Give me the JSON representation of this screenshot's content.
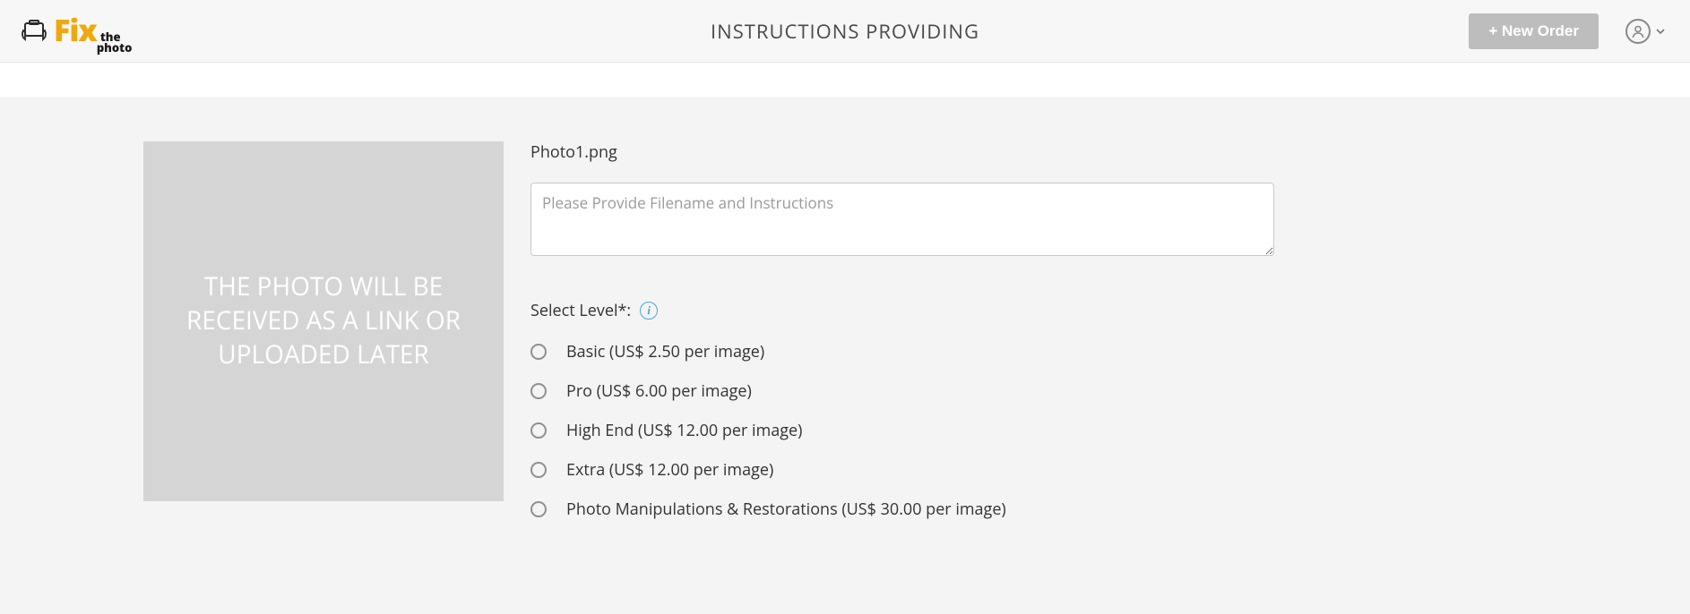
{
  "header": {
    "page_title": "INSTRUCTIONS PROVIDING",
    "new_order_label": "+ New Order",
    "logo": {
      "fix": "Fix",
      "the": "the",
      "photo": "photo"
    }
  },
  "photo": {
    "placeholder_text": "THE PHOTO WILL BE RECEIVED AS A LINK OR UPLOADED LATER"
  },
  "form": {
    "filename": "Photo1.png",
    "instructions_placeholder": "Please Provide Filename and Instructions",
    "select_level_label": "Select Level*:",
    "levels": [
      "Basic (US$ 2.50 per image)",
      "Pro (US$ 6.00 per image)",
      "High End (US$ 12.00 per image)",
      "Extra (US$ 12.00 per image)",
      "Photo Manipulations & Restorations (US$ 30.00 per image)"
    ]
  }
}
